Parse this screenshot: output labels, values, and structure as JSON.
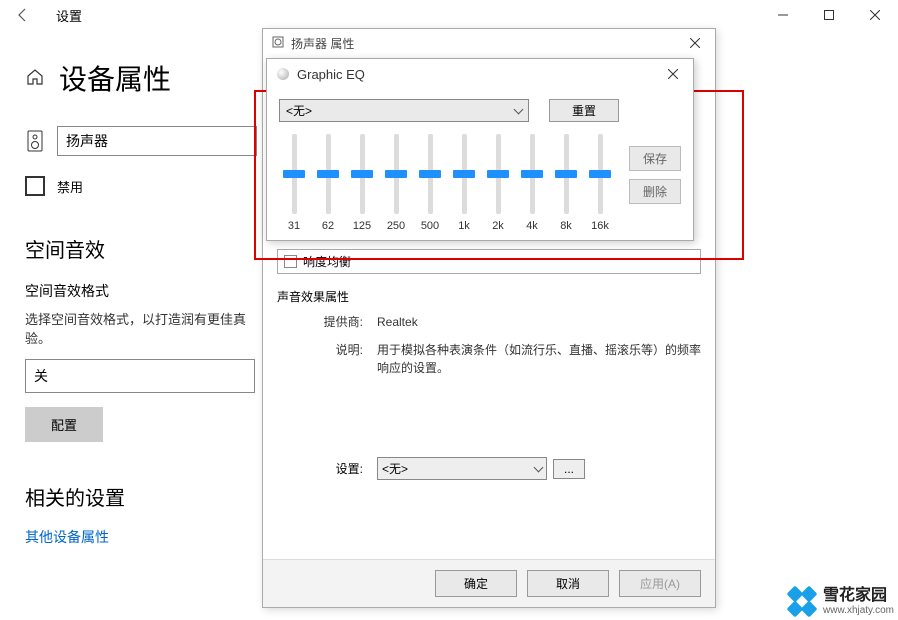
{
  "settings": {
    "window_title": "设置",
    "page_title": "设备属性",
    "device_name": "扬声器",
    "disable_label": "禁用",
    "spatial_h": "空间音效",
    "spatial_format_label": "空间音效格式",
    "spatial_desc": "选择空间音效格式，以打造润有更佳真验。",
    "spatial_off": "关",
    "config_btn": "配置",
    "related_h": "相关的设置",
    "other_link": "其他设备属性"
  },
  "props": {
    "title": "扬声器 属性",
    "loudness": "响度均衡",
    "sound_props_title": "声音效果属性",
    "provider_label": "提供商:",
    "provider_value": "Realtek",
    "desc_label": "说明:",
    "desc_value": "用于模拟各种表演条件（如流行乐、直播、摇滚乐等）的频率响应的设置。",
    "settings_label": "设置:",
    "preset": "<无>",
    "more": "...",
    "ok": "确定",
    "cancel": "取消",
    "apply": "应用(A)"
  },
  "eq": {
    "title": "Graphic EQ",
    "preset": "<无>",
    "reset": "重置",
    "save": "保存",
    "delete": "删除",
    "bands": [
      "31",
      "62",
      "125",
      "250",
      "500",
      "1k",
      "2k",
      "4k",
      "8k",
      "16k"
    ]
  },
  "watermark": {
    "name": "雪花家园",
    "url": "www.xhjaty.com"
  }
}
